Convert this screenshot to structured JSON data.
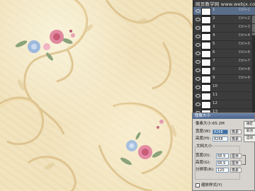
{
  "watermark": "网页教学网 www.webjx.com",
  "channels": [
    {
      "name": "1",
      "shortcut": "Ctrl+1",
      "selected": true
    },
    {
      "name": "2",
      "shortcut": "Ctrl+2"
    },
    {
      "name": "3",
      "shortcut": "Ctrl+3"
    },
    {
      "name": "4",
      "shortcut": "Ctrl+4"
    },
    {
      "name": "5",
      "shortcut": "Ctrl+5"
    },
    {
      "name": "6",
      "shortcut": "Ctrl+6"
    },
    {
      "name": "7",
      "shortcut": "Ctrl+7"
    },
    {
      "name": "8",
      "shortcut": "Ctrl+8"
    },
    {
      "name": "9",
      "shortcut": "Ctrl+9"
    },
    {
      "name": "10",
      "shortcut": ""
    },
    {
      "name": "11",
      "shortcut": ""
    },
    {
      "name": "12",
      "shortcut": ""
    },
    {
      "name": "13",
      "shortcut": ""
    }
  ],
  "dialog": {
    "title": "图像大小",
    "pixel_dimensions": "像素大小:65.2M",
    "width_label": "宽度(W):",
    "width_value": "8268",
    "width_unit": "像素",
    "height_label": "高度(H):",
    "height_value": "8268",
    "height_unit": "像素",
    "doc_size_label": "文档大小:",
    "doc_width_label": "宽度(D):",
    "doc_width_value": "68.9",
    "doc_width_unit": "厘米",
    "doc_height_label": "高度(G):",
    "doc_height_value": "68.9",
    "doc_height_unit": "厘米",
    "resolution_label": "分辨率(R):",
    "resolution_value": "120",
    "resolution_unit": "像素",
    "scale_styles_label": "缩放样式(Y)",
    "ok_label": "确定",
    "cancel_label": "取消",
    "auto_label": "自动"
  },
  "colors": {
    "wallpaper_base": "#f1e3bd",
    "scroll_ornament": "#d9bd80",
    "rose": "#d9788c",
    "blue_flower": "#8fb1d6",
    "selection": "#5a6e8a"
  }
}
